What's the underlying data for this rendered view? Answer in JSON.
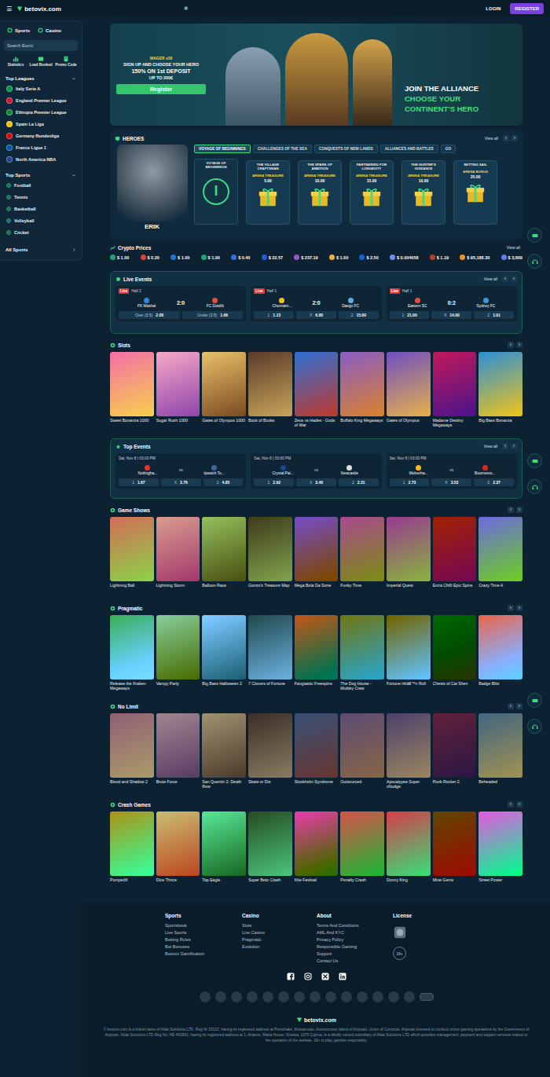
{
  "topbar": {
    "menu_icon": "☰",
    "logo": "betovix.com",
    "snow_icon": "❄",
    "login": "LOGIN",
    "register": "REGISTER"
  },
  "sidebar": {
    "tabs": [
      {
        "label": "Sports"
      },
      {
        "label": "Casino"
      }
    ],
    "search_placeholder": "Search Event",
    "shortcuts": [
      "Statistics",
      "Load Booked",
      "Promo Code"
    ],
    "top_leagues": {
      "title": "Top Leagues",
      "items": [
        {
          "label": "Italy Serie A",
          "color": "#009246"
        },
        {
          "label": "England Premier League",
          "color": "#cf142b"
        },
        {
          "label": "Ethiopia Premier League",
          "color": "#078930"
        },
        {
          "label": "Spain La Liga",
          "color": "#f1bf00"
        },
        {
          "label": "Germany Bundesliga",
          "color": "#dd0000"
        },
        {
          "label": "France Ligue 1",
          "color": "#0055a4"
        },
        {
          "label": "North America NBA",
          "color": "#1d428a"
        }
      ]
    },
    "top_sports": {
      "title": "Top Sports",
      "items": [
        "Football",
        "Tennis",
        "Basketball",
        "Volleyball",
        "Cricket"
      ]
    },
    "all_sports": "All Sports"
  },
  "banner": {
    "wager": "WAGER x30",
    "line1": "SIGN UP AND CHOOSE YOUR HERO",
    "line2": "150% ON 1st DEPOSIT",
    "line3": "UP TO 200€",
    "button": "Register",
    "headline": [
      "JOIN THE ALLIANCE",
      "CHOOSE YOUR",
      "CONTINENT'S HERO"
    ]
  },
  "arrows": [
    "‹",
    "›"
  ],
  "heroes": {
    "title": "HEROES",
    "view_all": "View all",
    "hero_name": "ERIK",
    "tabs": [
      {
        "label": "VOYAGE OF BEGINNINGS",
        "selected": true
      },
      {
        "label": "CHALLENGES OF THE SEA",
        "selected": false
      },
      {
        "label": "CONQUESTS OF NEW LANDS",
        "selected": false
      },
      {
        "label": "ALLIANCES AND BATTLES",
        "selected": false
      },
      {
        "label": "GO",
        "selected": false
      }
    ],
    "cards": [
      {
        "kind": "chapter",
        "title": "VOYAGE OF BEGINNINGS",
        "numeral": "I"
      },
      {
        "kind": "reward",
        "title": "THE VILLAGE CRAFTSMAN",
        "reward": "ARENA TREASURE",
        "amount": "5.00"
      },
      {
        "kind": "reward",
        "title": "THE SPARK OF AMBITION",
        "reward": "ARENA TREASURE",
        "amount": "10.00"
      },
      {
        "kind": "reward",
        "title": "PARTNERING FOR LONGEVITY",
        "reward": "ARENA TREASURE",
        "amount": "15.00"
      },
      {
        "kind": "reward",
        "title": "THE HUNTER'S GUIDANCE",
        "reward": "ARENA TREASURE",
        "amount": "10.00"
      },
      {
        "kind": "reward",
        "title": "SETTING SAIL",
        "reward": "ARENA BONUS",
        "amount": "25.00"
      }
    ]
  },
  "crypto": {
    "title": "Crypto Prices",
    "view_all": "View all",
    "coins": [
      {
        "price": "$ 1.00",
        "color": "#26a17b"
      },
      {
        "price": "$ 0.20",
        "color": "#e23d3d"
      },
      {
        "price": "$ 1.00",
        "color": "#2775ca"
      },
      {
        "price": "$ 1.00",
        "color": "#26a17b"
      },
      {
        "price": "$ 0.40",
        "color": "#3c6fd8"
      },
      {
        "price": "$ 22.57",
        "color": "#2a5ada"
      },
      {
        "price": "$ 237.19",
        "color": "#9b59b6"
      },
      {
        "price": "$ 1.00",
        "color": "#f5ac37"
      },
      {
        "price": "$ 2.50",
        "color": "#1c5fd1"
      },
      {
        "price": "$ 0.004058",
        "color": "#6d8ef0"
      },
      {
        "price": "$ 1.19",
        "color": "#c0392b"
      },
      {
        "price": "$ 95,186.30",
        "color": "#f7931a"
      },
      {
        "price": "$ 3,609",
        "color": "#627eea"
      }
    ]
  },
  "live_events": {
    "title": "Live Events",
    "view_all": "View all",
    "events": [
      {
        "badge": "Live",
        "period": "Half 2",
        "home": {
          "name": "FK Mashal",
          "color": "#2e86de"
        },
        "score": "2:0",
        "away": {
          "name": "FC Dostlik",
          "color": "#e74c3c"
        },
        "odds": [
          {
            "label": "Over (3.5)",
            "value": "2.08"
          },
          {
            "label": "Under (3.5)",
            "value": "1.66"
          }
        ]
      },
      {
        "badge": "Live",
        "period": "Half 1",
        "home": {
          "name": "Chunnam...",
          "color": "#f1c40f"
        },
        "score": "2:0",
        "away": {
          "name": "Daegu FC",
          "color": "#5dade2"
        },
        "odds": [
          {
            "label": "1",
            "value": "1.13"
          },
          {
            "label": "X",
            "value": "6.80"
          },
          {
            "label": "2",
            "value": "15.00"
          }
        ]
      },
      {
        "badge": "Live",
        "period": "Half 1",
        "home": {
          "name": "Eastern SC",
          "color": "#e74c3c"
        },
        "score": "0:2",
        "away": {
          "name": "Sydney FC",
          "color": "#3498db"
        },
        "odds": [
          {
            "label": "1",
            "value": "21.00"
          },
          {
            "label": "X",
            "value": "14.00"
          },
          {
            "label": "2",
            "value": "1.01"
          }
        ]
      }
    ]
  },
  "top_events": {
    "title": "Top Events",
    "view_all": "View all",
    "events": [
      {
        "date": "Sat, Nov 8 | 03:00 PM",
        "home": {
          "name": "Nottingha...",
          "color": "#e53233"
        },
        "vs": "vs",
        "away": {
          "name": "Ipswich To...",
          "color": "#3a64a3"
        },
        "odds": [
          {
            "label": "1",
            "value": "1.67"
          },
          {
            "label": "X",
            "value": "3.76"
          },
          {
            "label": "2",
            "value": "4.85"
          }
        ]
      },
      {
        "date": "Sat, Nov 8 | 03:00 PM",
        "home": {
          "name": "Crystal Pal...",
          "color": "#1b458f"
        },
        "vs": "vs",
        "away": {
          "name": "Newcastle",
          "color": "#dddddd"
        },
        "odds": [
          {
            "label": "1",
            "value": "2.92"
          },
          {
            "label": "X",
            "value": "3.40"
          },
          {
            "label": "2",
            "value": "2.31"
          }
        ]
      },
      {
        "date": "Sat, Nov 8 | 03:00 PM",
        "home": {
          "name": "Wolverha...",
          "color": "#fdb913"
        },
        "vs": "vs",
        "away": {
          "name": "Bournemo...",
          "color": "#da291c"
        },
        "odds": [
          {
            "label": "1",
            "value": "2.73"
          },
          {
            "label": "X",
            "value": "3.53"
          },
          {
            "label": "2",
            "value": "2.37"
          }
        ]
      }
    ]
  },
  "game_sections": [
    {
      "title": "Slots",
      "items": [
        "Sweet Bonanza 1000",
        "Sugar Rush 1000",
        "Gates of Olympus 1000",
        "Book of Books",
        "Zeus vs Hades - Gods of War",
        "Buffalo King Megaways",
        "Gates of Olympus",
        "Madame Destiny Megaways",
        "Big Bass Bonanza"
      ]
    },
    {
      "title": "Game Shows",
      "items": [
        "Lightning Ball",
        "Lightning Storm",
        "Balloon Race",
        "Gonzo's Treasure Map",
        "Mega Bola Da Sorte",
        "Funky Time",
        "Imperial Quest",
        "Extra Chilli Epic Spins",
        "Crazy Time A"
      ]
    },
    {
      "title": "Pragmatic",
      "items": [
        "Release the Kraken Megaways",
        "Vampy Party",
        "Big Bass Halloween 2",
        "7 Clovers of Fortune",
        "Fangtastic Freespins",
        "The Dog House - Muttley Crew",
        "Fortune Hitâ€™n Roll",
        "Chests of Cai Shen",
        "Badge Blitz"
      ]
    },
    {
      "title": "No Limit",
      "items": [
        "Blood and Shadow 2",
        "Brute Force",
        "San Quentin 2: Death Row",
        "Skate or Die",
        "Stockholm Syndrome",
        "Outsourced",
        "Apocalypse Super xNudge",
        "Punk Rocker 2",
        "Beheaded"
      ]
    },
    {
      "title": "Crash Games",
      "items": [
        "PumpedX",
        "Dice Thrice",
        "Top Eagle",
        "Super Beto Crash",
        "Kite Festival",
        "Penalty Crash",
        "Donny King",
        "Mine Gems",
        "Street Power"
      ]
    }
  ],
  "footer": {
    "columns": [
      {
        "title": "Sports",
        "links": [
          "Sportsbook",
          "Live Sports",
          "Betting Rules",
          "Bet Bonuses",
          "Betovix Gamification"
        ]
      },
      {
        "title": "Casino",
        "links": [
          "Slots",
          "Live Casino",
          "Pragmatic",
          "Evolution"
        ]
      },
      {
        "title": "About",
        "links": [
          "Terms And Conditions",
          "AML And KYC",
          "Privacy Policy",
          "Responsible Gaming",
          "Support",
          "Contact Us"
        ]
      }
    ],
    "license": {
      "title": "License",
      "age": "18+"
    },
    "logo": "betovix.com",
    "legal": "© betovix.com is a brand name of Atlas Solutions LTD, Reg Nr 15122, having its registered address at Pomchake, Mutsamudu, Autonomous Island of Anjouan, Union of Comoros. Anjouan licensed to conduct online gaming operations by the Government of Anjouan. Atlas Solutions LTD Reg No. HE 462841, having its registered address at 1, Arianos, Maria House, Nicosia, 1075 Cyprus, is a wholly owned subsidiary of Atlas Solutions LTD which provides management, payment and support services related to the operation of the website. 18+ to play, gamble responsibly."
  }
}
